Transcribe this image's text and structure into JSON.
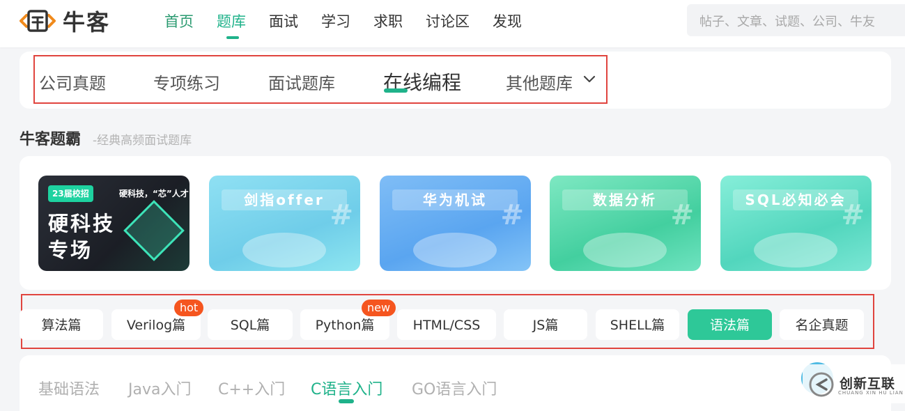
{
  "logo": {
    "text": "牛客"
  },
  "nav": {
    "items": [
      {
        "label": "首页",
        "state": "home"
      },
      {
        "label": "题库",
        "state": "active"
      },
      {
        "label": "面试",
        "state": ""
      },
      {
        "label": "学习",
        "state": ""
      },
      {
        "label": "求职",
        "state": ""
      },
      {
        "label": "讨论区",
        "state": ""
      },
      {
        "label": "发现",
        "state": ""
      }
    ]
  },
  "search": {
    "placeholder": "帖子、文章、试题、公司、牛友"
  },
  "subtabs": {
    "items": [
      "公司真题",
      "专项练习",
      "面试题库",
      "在线编程",
      "其他题库"
    ],
    "active_index": 3
  },
  "section": {
    "title": "牛客题霸",
    "subtitle": "-经典高频面试题库"
  },
  "banners": {
    "featured": {
      "badge": "23届校招",
      "tagline": "硬科技，“芯”人才",
      "title_line1": "硬科技",
      "title_line2": "专场"
    },
    "cards": [
      {
        "title": "剑指offer"
      },
      {
        "title": "华为机试"
      },
      {
        "title": "数据分析"
      },
      {
        "title": "SQL必知必会"
      }
    ]
  },
  "categories": {
    "items": [
      "算法篇",
      "Verilog篇",
      "SQL篇",
      "Python篇",
      "HTML/CSS",
      "JS篇",
      "SHELL篇",
      "语法篇",
      "名企真题"
    ],
    "active_index": 7,
    "tags": {
      "verilog": "hot",
      "python": "new"
    }
  },
  "langtabs": {
    "items": [
      "基础语法",
      "Java入门",
      "C++入门",
      "C语言入门",
      "GO语言入门"
    ],
    "active_index": 3
  },
  "watermark": {
    "text": "创新互联",
    "sub": "CHUANG XIN HU LIAN"
  },
  "colors": {
    "accent": "#1fb28a",
    "highlight_box": "#e0443e",
    "tag": "#f5551f"
  }
}
